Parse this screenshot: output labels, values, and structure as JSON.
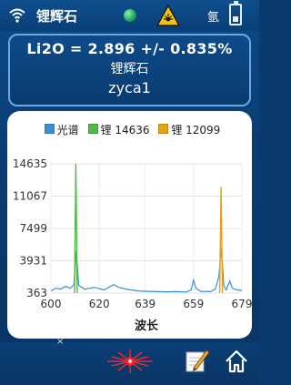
{
  "statusbar": {
    "title": "锂辉石",
    "gas_label": "氩",
    "icons": [
      "wifi-icon",
      "status-dot-icon",
      "laser-warning-icon",
      "battery-icon"
    ],
    "status_color": "#22b35f"
  },
  "result": {
    "formula": "Li2O = 2.896 +/- 0.835%",
    "mineral": "锂辉石",
    "sample": "zyca1"
  },
  "legend": [
    {
      "label": "光谱",
      "color": "#3a8fd4"
    },
    {
      "label": "锂 14636",
      "color": "#55b84a"
    },
    {
      "label": "锂 12099",
      "color": "#e3a21a"
    }
  ],
  "chart_data": {
    "type": "line",
    "xlabel": "波长",
    "ylabel": "",
    "xlim": [
      600,
      679
    ],
    "ylim": [
      363,
      14635
    ],
    "x_ticks": [
      "600",
      "620",
      "639",
      "659",
      "679"
    ],
    "y_ticks": [
      "14635",
      "11067",
      "7499",
      "3931",
      "363"
    ],
    "series": [
      {
        "name": "光谱",
        "color": "#3a8fd4",
        "points": [
          [
            600,
            600
          ],
          [
            602,
            900
          ],
          [
            604,
            800
          ],
          [
            606,
            1100
          ],
          [
            608,
            900
          ],
          [
            609.5,
            1300
          ],
          [
            610.5,
            5000
          ],
          [
            611.5,
            1200
          ],
          [
            614,
            800
          ],
          [
            618,
            1000
          ],
          [
            622,
            700
          ],
          [
            626,
            1300
          ],
          [
            628,
            1000
          ],
          [
            632,
            750
          ],
          [
            636,
            600
          ],
          [
            640,
            550
          ],
          [
            644,
            520
          ],
          [
            648,
            500
          ],
          [
            652,
            520
          ],
          [
            656,
            480
          ],
          [
            658,
            700
          ],
          [
            659,
            1800
          ],
          [
            660,
            900
          ],
          [
            662,
            550
          ],
          [
            666,
            520
          ],
          [
            668,
            800
          ],
          [
            669.5,
            2200
          ],
          [
            670.5,
            5300
          ],
          [
            671.5,
            1200
          ],
          [
            672.5,
            700
          ],
          [
            674,
            1700
          ],
          [
            675,
            900
          ],
          [
            677,
            700
          ],
          [
            679,
            650
          ]
        ]
      },
      {
        "name": "锂 14636",
        "color": "#55b84a",
        "peak_x": 610.3,
        "peak_y": 14636
      },
      {
        "name": "锂 12099",
        "color": "#e3a21a",
        "peak_x": 670.4,
        "peak_y": 12099
      }
    ]
  },
  "bottombar": {
    "icons": [
      "close-mark-icon",
      "laser-fire-icon",
      "edit-icon",
      "home-icon"
    ],
    "close_mark": "×"
  }
}
